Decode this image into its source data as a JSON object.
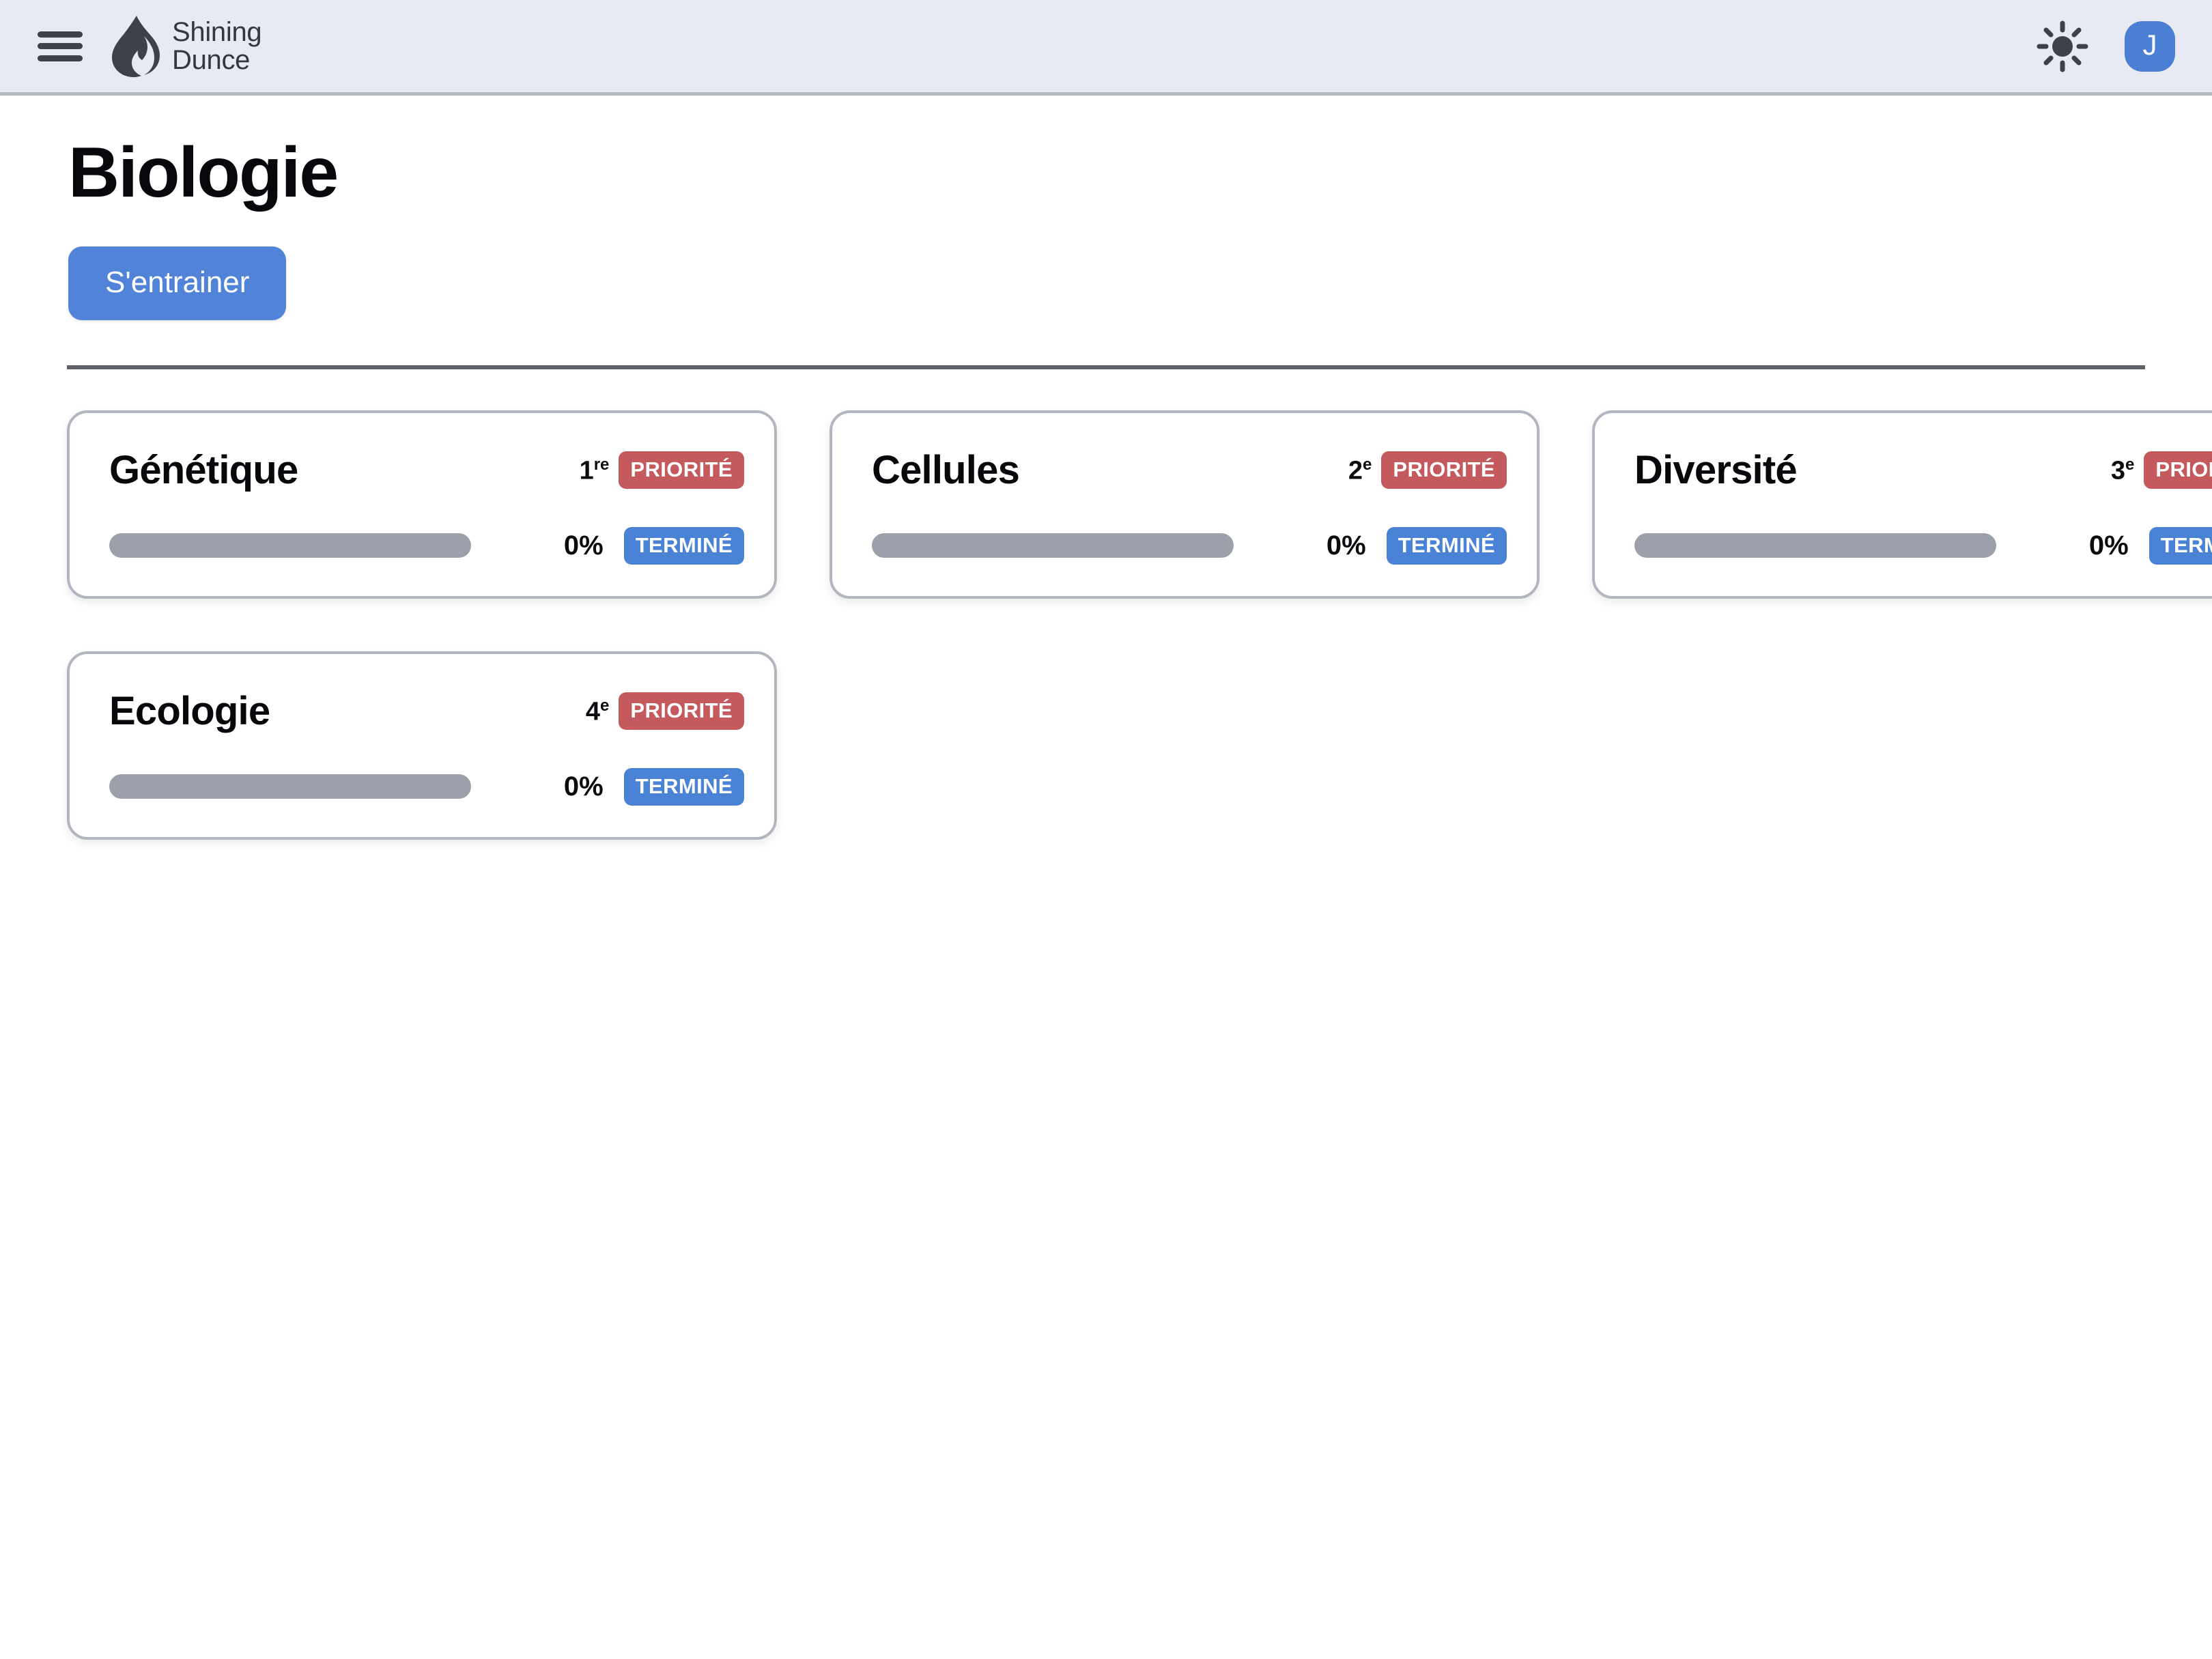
{
  "header": {
    "menu_label": "Menu",
    "brand_line1": "Shining",
    "brand_line2": "Dunce",
    "theme_icon": "sun-icon",
    "avatar_initial": "J"
  },
  "page": {
    "title": "Biologie",
    "practice_button": "S'entrainer"
  },
  "colors": {
    "accent_blue": "#5184d8",
    "badge_priority_red": "#c4595e",
    "badge_done_blue": "#4a83d6",
    "progress_track_grey": "#9ca0ab",
    "header_bg": "#e7eaf2"
  },
  "cards": [
    {
      "title": "Génétique",
      "rank_number": "1",
      "rank_suffix": "re",
      "priority_label": "PRIORITÉ",
      "percent_label": "0%",
      "percent_value": 0,
      "done_label": "TERMINÉ"
    },
    {
      "title": "Cellules",
      "rank_number": "2",
      "rank_suffix": "e",
      "priority_label": "PRIORITÉ",
      "percent_label": "0%",
      "percent_value": 0,
      "done_label": "TERMINÉ"
    },
    {
      "title": "Diversité",
      "rank_number": "3",
      "rank_suffix": "e",
      "priority_label": "PRIORITÉ",
      "percent_label": "0%",
      "percent_value": 0,
      "done_label": "TERMINÉ"
    },
    {
      "title": "Ecologie",
      "rank_number": "4",
      "rank_suffix": "e",
      "priority_label": "PRIORITÉ",
      "percent_label": "0%",
      "percent_value": 0,
      "done_label": "TERMINÉ"
    }
  ]
}
